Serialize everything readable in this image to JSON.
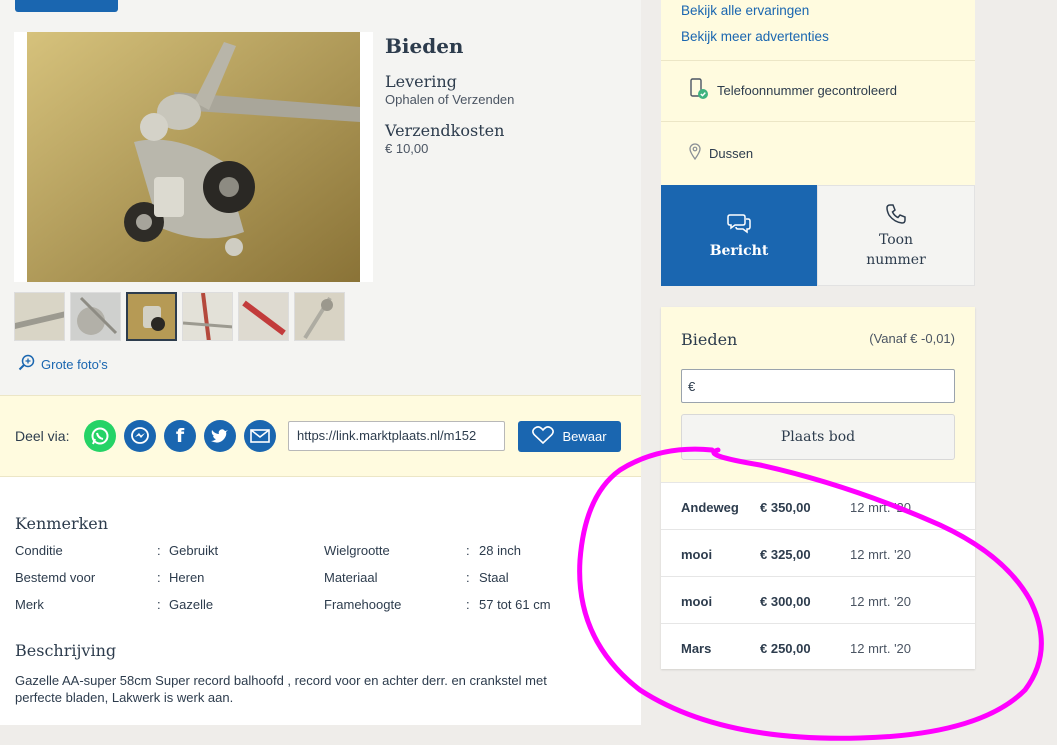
{
  "listing": {
    "bid_heading": "Bieden",
    "delivery_label": "Levering",
    "delivery_value": "Ophalen of Verzenden",
    "shipping_label": "Verzendkosten",
    "shipping_value": "€ 10,00",
    "grote_fotos": "Grote foto's"
  },
  "share": {
    "label": "Deel via:",
    "url": "https://link.marktplaats.nl/m152",
    "save_label": "Bewaar"
  },
  "features": {
    "heading": "Kenmerken",
    "rows": [
      {
        "k1": "Conditie",
        "v1": "Gebruikt",
        "k2": "Wielgrootte",
        "v2": "28 inch"
      },
      {
        "k1": "Bestemd voor",
        "v1": "Heren",
        "k2": "Materiaal",
        "v2": "Staal"
      },
      {
        "k1": "Merk",
        "v1": "Gazelle",
        "k2": "Framehoogte",
        "v2": "57 tot 61 cm"
      }
    ],
    "separator": ":"
  },
  "description": {
    "heading": "Beschrijving",
    "text": "Gazelle AA-super 58cm Super record balhoofd , record voor en achter derr. en crankstel met perfecte bladen, Lakwerk is werk aan."
  },
  "seller": {
    "link_reviews": "Bekijk alle ervaringen",
    "link_more_ads": "Bekijk meer advertenties",
    "phone_verified": "Telefoonnummer gecontroleerd",
    "location": "Dussen"
  },
  "contact": {
    "message_label": "Bericht",
    "phone_label_line1": "Toon",
    "phone_label_line2": "nummer"
  },
  "bidding": {
    "title": "Bieden",
    "minimum": "(Vanaf € -0,01)",
    "input_prefix": "€",
    "place_bid": "Plaats bod",
    "bids": [
      {
        "name": "Andeweg",
        "amount": "€ 350,00",
        "date": "12 mrt. '20"
      },
      {
        "name": "mooi",
        "amount": "€ 325,00",
        "date": "12 mrt. '20"
      },
      {
        "name": "mooi",
        "amount": "€ 300,00",
        "date": "12 mrt. '20"
      },
      {
        "name": "Mars",
        "amount": "€ 250,00",
        "date": "12 mrt. '20"
      }
    ]
  },
  "colors": {
    "brand_blue": "#1a66b0",
    "highlight_yellow": "#fffbdf",
    "annotation_magenta": "#ff00ff",
    "whatsapp": "#25d366",
    "messenger": "#1a66b0",
    "facebook": "#1a66b0",
    "twitter": "#1a66b0",
    "email": "#1a66b0"
  },
  "icons": [
    "whatsapp-icon",
    "messenger-icon",
    "facebook-icon",
    "twitter-icon",
    "email-icon",
    "heart-icon",
    "zoom-icon",
    "phone-verified-icon",
    "location-pin-icon",
    "chat-icon",
    "phone-icon"
  ]
}
